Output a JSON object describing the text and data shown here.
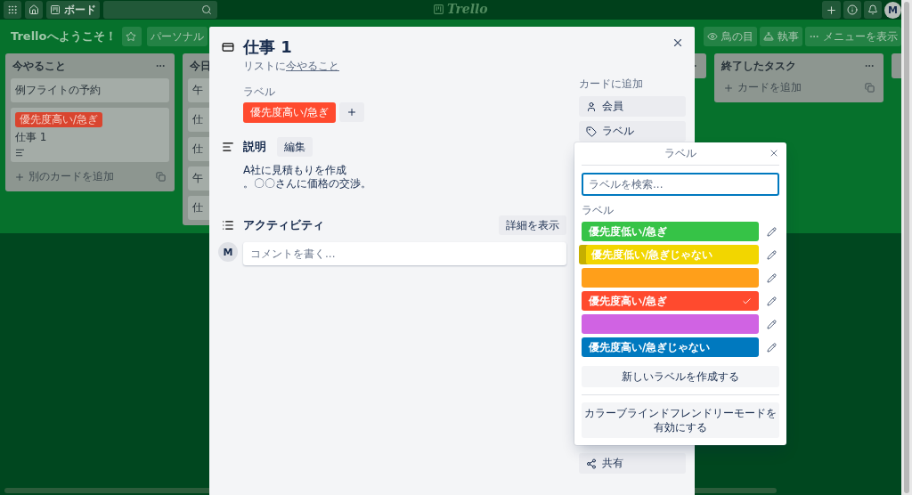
{
  "header": {
    "board_button": "ボード",
    "logo": "Trello",
    "avatar": "M"
  },
  "board": {
    "title": "Trelloへようこそ！",
    "visibility": "パーソナル",
    "actions": [
      {
        "kind": "eye",
        "label": "鳥の目"
      },
      {
        "kind": "butler",
        "label": "執事"
      },
      {
        "kind": "menu",
        "label": "メニューを表示"
      }
    ]
  },
  "lists": [
    {
      "kind": "full",
      "title": "今やること",
      "cards": [
        {
          "title": "例フライトの予約"
        },
        {
          "title": "仕事 1",
          "labels": [
            {
              "text": "優先度高い/急ぎ",
              "color": "#d9452f"
            }
          ],
          "has_description": true
        }
      ],
      "add": "別のカードを追加"
    },
    {
      "kind": "full",
      "title": "今日",
      "cards": [
        {
          "title": "午"
        },
        {
          "title": "仕"
        },
        {
          "title": "仕"
        },
        {
          "title": "午"
        },
        {
          "title": "仕"
        }
      ]
    },
    {
      "kind": "hidden"
    },
    {
      "kind": "edge"
    },
    {
      "kind": "full",
      "title": "終了したタスク",
      "add": "カードを追加"
    },
    {
      "kind": "edge"
    }
  ],
  "card": {
    "title": "仕事 1",
    "list_prefix": "リストに",
    "list_name": "今やること",
    "labels_heading": "ラベル",
    "labels": [
      {
        "text": "優先度高い/急ぎ",
        "color": "#ff4a2e"
      }
    ],
    "description_heading": "説明",
    "edit_button": "編集",
    "description_lines": [
      "A社に見積もりを作成",
      "。〇〇さんに価格の交渉。"
    ],
    "activity_heading": "アクティビティ",
    "details_button": "詳細を表示",
    "comment": {
      "avatar": "M",
      "placeholder": "コメントを書く..."
    },
    "sidebar": {
      "heading": "カードに追加",
      "buttons": [
        {
          "kind": "member",
          "label": "会員"
        },
        {
          "kind": "label",
          "label": "ラベル"
        }
      ],
      "share": "共有"
    }
  },
  "popover": {
    "title": "ラベル",
    "search": {
      "placeholder": "ラベルを検索...",
      "focused": true
    },
    "heading": "ラベル",
    "labels": [
      {
        "text": "優先度低い/急ぎ",
        "color": "#36c347",
        "selected": false,
        "hovered": false
      },
      {
        "text": "優先度低い/急ぎじゃない",
        "color": "#f2d600",
        "selected": false,
        "hovered": true
      },
      {
        "color": "#ff9f1a",
        "selected": false,
        "hovered": false
      },
      {
        "text": "優先度高い/急ぎ",
        "color": "#ff4a2e",
        "selected": true,
        "hovered": false
      },
      {
        "color": "#d063e3",
        "selected": false,
        "hovered": false
      },
      {
        "text": "優先度高い/急ぎじゃない",
        "color": "#0079bf",
        "selected": false,
        "hovered": false
      }
    ],
    "create_button": "新しいラベルを作成する",
    "colorblind_button_lines": [
      "カラーブラインドフレンドリーモードを",
      "有効にする"
    ]
  }
}
